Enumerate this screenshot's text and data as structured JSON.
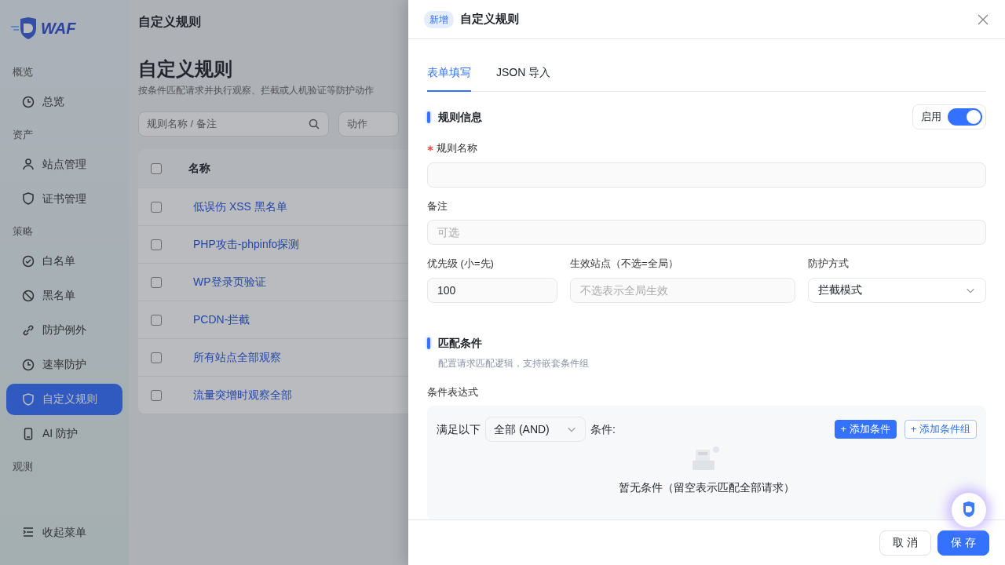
{
  "sidebar": {
    "logo": "WAF",
    "groups": [
      {
        "label": "概览",
        "items": [
          {
            "label": "总览",
            "kind": "clock",
            "selected": false
          }
        ]
      },
      {
        "label": "资产",
        "items": [
          {
            "label": "站点管理",
            "kind": "people",
            "selected": false
          },
          {
            "label": "证书管理",
            "kind": "shield",
            "selected": false
          }
        ]
      },
      {
        "label": "策略",
        "items": [
          {
            "label": "白名单",
            "kind": "check",
            "selected": false
          },
          {
            "label": "黑名单",
            "kind": "ban",
            "selected": false
          },
          {
            "label": "防护例外",
            "kind": "link",
            "selected": false
          },
          {
            "label": "速率防护",
            "kind": "clock",
            "selected": false
          },
          {
            "label": "自定义规则",
            "kind": "shield",
            "selected": true
          },
          {
            "label": "AI 防护",
            "kind": "phone",
            "selected": false
          }
        ]
      },
      {
        "label": "观测"
      }
    ],
    "collapse": "收起菜单"
  },
  "page": {
    "header": "自定义规则",
    "title": "自定义规则",
    "subtitle": "按条件匹配请求并执行观察、拦截或人机验证等防护动作",
    "search": {
      "placeholder": "规则名称 / 备注"
    },
    "filter": {
      "placeholder": "动作"
    },
    "table": {
      "columns": [
        "名称"
      ],
      "all_checked": false,
      "rows": [
        {
          "name": "低误伤 XSS 黑名单",
          "checked": false
        },
        {
          "name": "PHP攻击-phpinfo探测",
          "checked": false
        },
        {
          "name": "WP登录页验证",
          "checked": false
        },
        {
          "name": "PCDN-拦截",
          "checked": false
        },
        {
          "name": "所有站点全部观察",
          "checked": false
        },
        {
          "name": "流量突增时观察全部",
          "checked": false
        }
      ]
    }
  },
  "drawer": {
    "badge": "新增",
    "title": "自定义规则",
    "tabs": [
      {
        "label": "表单填写",
        "selected": true
      },
      {
        "label": "JSON 导入",
        "selected": false
      }
    ],
    "info_section": {
      "title": "规则信息",
      "switch": {
        "label": "启用",
        "on": true
      }
    },
    "fields": [
      {
        "label": "规则名称",
        "required": true,
        "kind": "input"
      },
      {
        "label": "备注",
        "kind": "input",
        "placeholder": "可选"
      }
    ],
    "row_fields": [
      {
        "label": "优先级 (小=先)",
        "kind": "input",
        "value": "100"
      },
      {
        "label": "生效站点（不选=全局）",
        "kind": "input",
        "placeholder": "不选表示全局生效"
      },
      {
        "label": "防护方式",
        "kind": "select",
        "value": "拦截模式"
      }
    ],
    "match_section": {
      "title": "匹配条件",
      "description": "配置请求匹配逻辑，支持嵌套条件组"
    },
    "expression": {
      "label": "条件表达式",
      "prefix": "满足以下",
      "logic": "全部 (AND)",
      "suffix": "条件:",
      "add_condition": "+ 添加条件",
      "add_group": "+ 添加条件组",
      "empty": "暂无条件（留空表示匹配全部请求）"
    },
    "buttons": [
      {
        "label": "取 消",
        "kind": "secondary"
      },
      {
        "label": "保 存",
        "kind": "primary"
      }
    ]
  }
}
